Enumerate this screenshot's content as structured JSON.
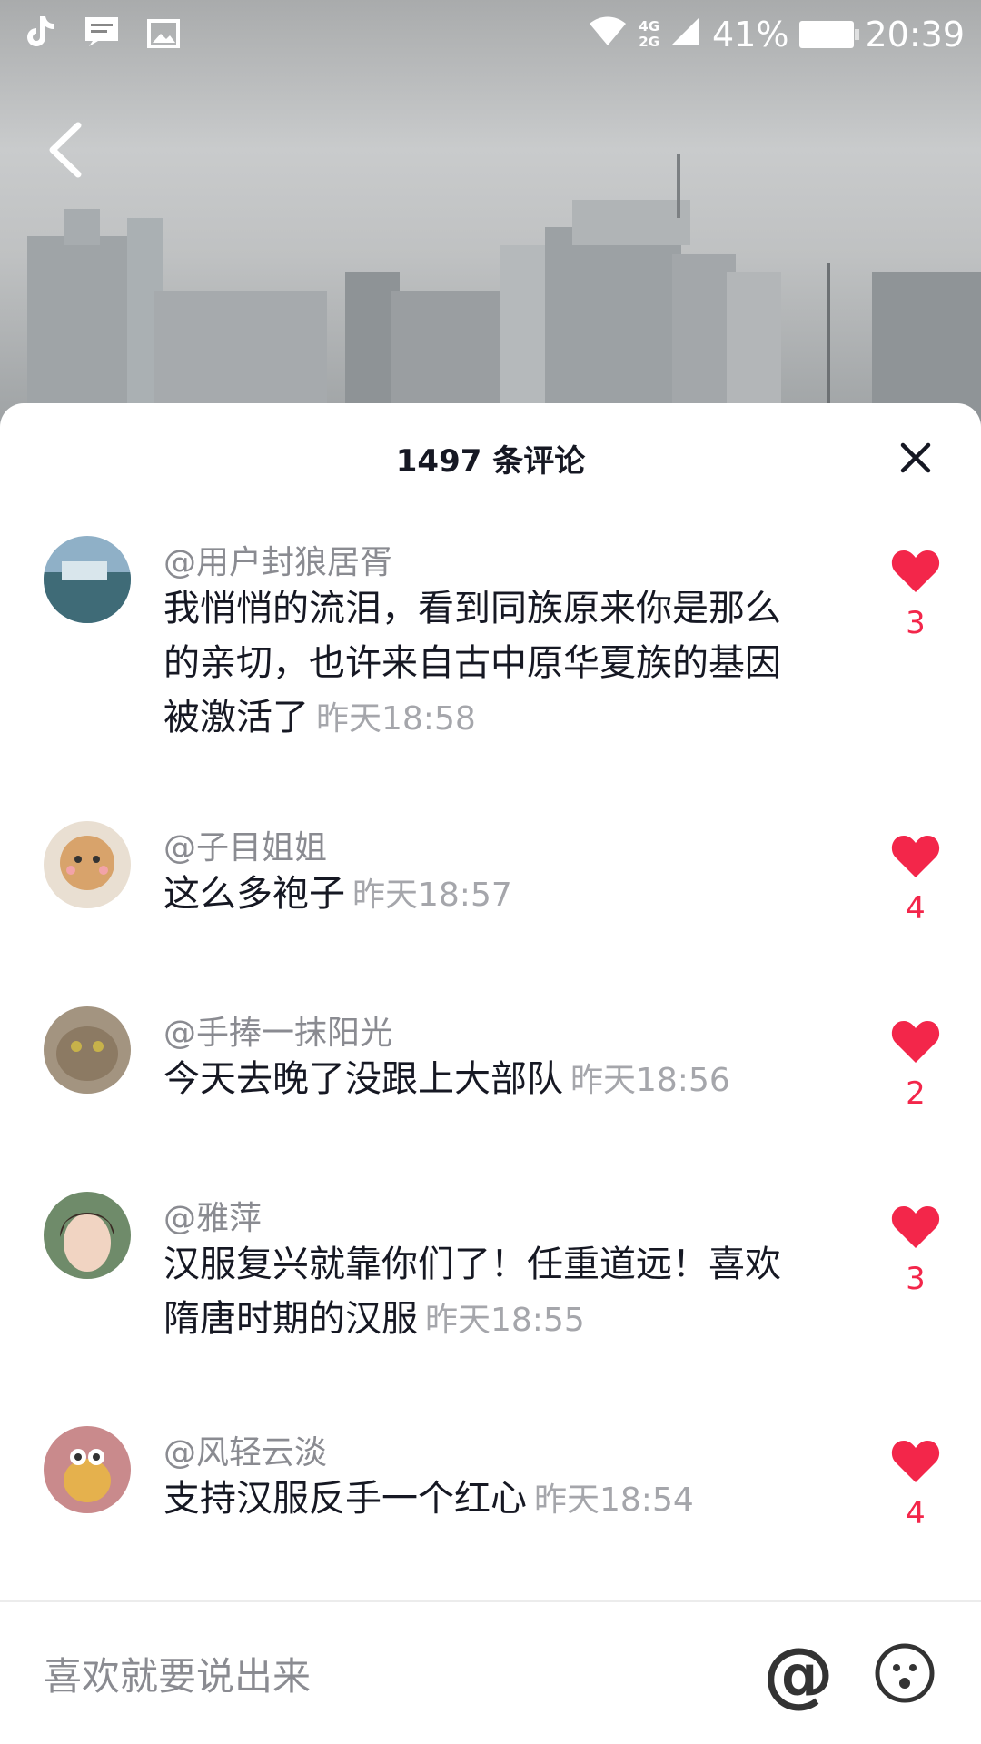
{
  "status_bar": {
    "network": "4G\n2G",
    "battery": "41%",
    "time": "20:39"
  },
  "sheet": {
    "title": "1497 条评论"
  },
  "comments": [
    {
      "user": "@用户封狼居胥",
      "text": "我悄悄的流泪，看到同族原来你是那么的亲切，也许来自古中原华夏族的基因被激活了",
      "time": "昨天18:58",
      "likes": "3"
    },
    {
      "user": "@子目姐姐",
      "text": "这么多袍子",
      "time": "昨天18:57",
      "likes": "4"
    },
    {
      "user": "@手捧一抹阳光",
      "text": "今天去晚了没跟上大部队",
      "time": "昨天18:56",
      "likes": "2"
    },
    {
      "user": "@雅萍",
      "text": "汉服复兴就靠你们了！任重道远！喜欢隋唐时期的汉服",
      "time": "昨天18:55",
      "likes": "3"
    },
    {
      "user": "@风轻云淡",
      "text": "支持汉服反手一个红心",
      "time": "昨天18:54",
      "likes": "4"
    }
  ],
  "input": {
    "placeholder": "喜欢就要说出来",
    "at_label": "@"
  },
  "colors": {
    "like": "#f3264a",
    "text_primary": "#161823",
    "text_secondary": "#8a8b91"
  }
}
